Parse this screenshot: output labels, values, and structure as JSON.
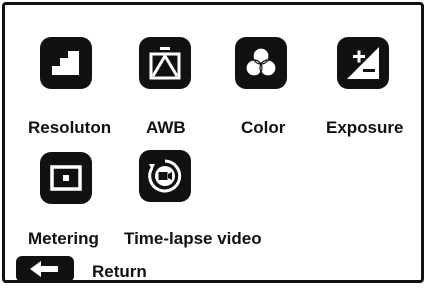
{
  "menu": {
    "items": [
      {
        "id": "resolution",
        "label": "Resoluton",
        "icon": "stairs-icon"
      },
      {
        "id": "awb",
        "label": "AWB",
        "icon": "awb-icon"
      },
      {
        "id": "color",
        "label": "Color",
        "icon": "color-circles-icon"
      },
      {
        "id": "exposure",
        "label": "Exposure",
        "icon": "exposure-plus-minus-icon"
      },
      {
        "id": "metering",
        "label": "Metering",
        "icon": "metering-frame-icon"
      },
      {
        "id": "timelapse",
        "label": "Time-lapse video",
        "icon": "timelapse-camera-icon"
      }
    ]
  },
  "footer": {
    "return_label": "Return",
    "return_icon": "back-arrow-icon"
  },
  "colors": {
    "icon_bg": "#111111",
    "icon_fg": "#ffffff",
    "text": "#111111",
    "background": "#ffffff"
  }
}
